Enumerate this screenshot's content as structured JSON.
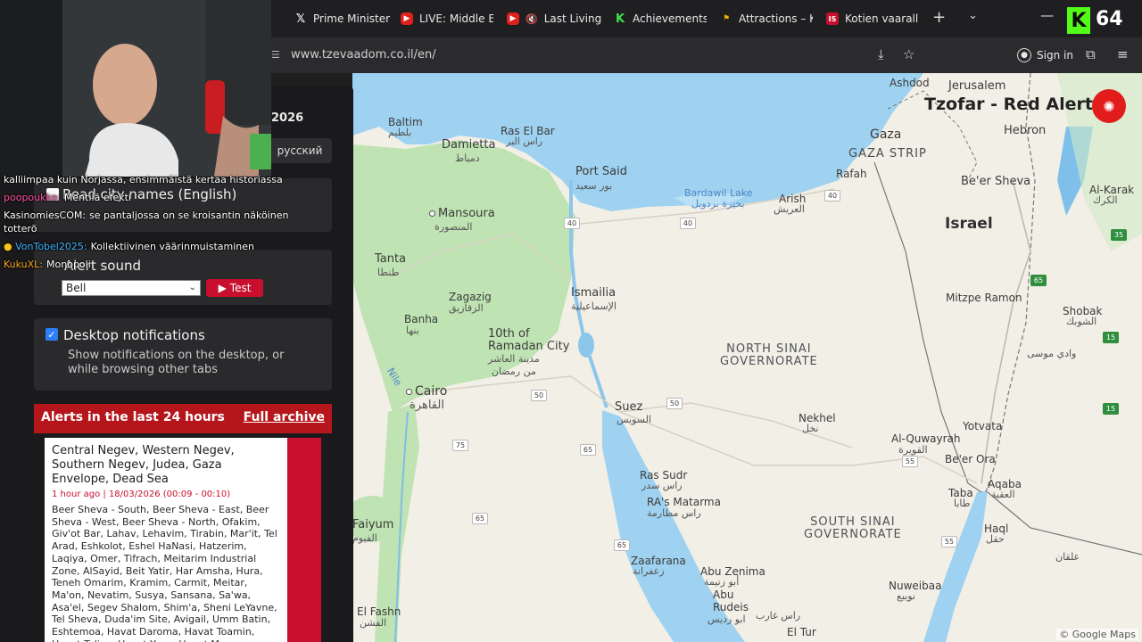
{
  "browser": {
    "tabs": [
      {
        "label": "Prime Minister",
        "favicon": "x-logo-icon"
      },
      {
        "label": "LIVE: Middle Ea",
        "favicon": "youtube-icon"
      },
      {
        "label": "Last Living",
        "favicon": "youtube-icon"
      },
      {
        "label": "Achievements -",
        "favicon": "kick-icon"
      },
      {
        "label": "Attractions – Ku",
        "favicon": "flag-icon"
      },
      {
        "label": "Kotien vaarallis",
        "favicon": "is-icon"
      }
    ],
    "url": "www.tzevaadom.co.il/en/",
    "signin_label": "Sign in",
    "viewer_count": "64",
    "kick_badge": "K"
  },
  "site": {
    "brand": "Tzofar - Red Alert",
    "year_partial": "2026",
    "language_button": "русский",
    "read_city_names": "Read city names (English)",
    "alert_sound_label": "Alert sound",
    "sound_selected": "Bell",
    "test_button": "Test",
    "desktop_notifications_title": "Desktop notifications",
    "desktop_notifications_desc": "Show notifications on the desktop, or while browsing other tabs",
    "alerts_header": "Alerts in the last 24 hours",
    "full_archive": "Full archive",
    "alert": {
      "regions": "Central Negev, Western Negev, Southern Negev, Judea, Gaza Envelope, Dead Sea",
      "time": "1 hour ago | 18/03/2026 (00:09 - 00:10)",
      "cities": "Beer Sheva - South, Beer Sheva - East, Beer Sheva - West, Beer Sheva - North, Ofakim, Giv'ot Bar, Lahav, Lehavim, Tirabin, Mar'it, Tel Arad, Eshkolot, Eshel HaNasi, Hatzerim, Laqiya, Omer, Tifrach, Meitarim Industrial Zone, AlSayid, Beit Yatir, Har Amsha, Hura, Teneh Omarim, Kramim, Carmit, Meitar, Ma'on, Nevatim, Susya, Sansana, Sa'wa, Asa'el, Segev Shalom, Shim'a, Sheni LeYavne, Tel Sheva, Duda'im Site, Avigail, Umm Batin, Eshtemoa, Havat Daroma, Havat Toamin, Havat Taliya, Havat Yoyo, Havat Mor Ve'Avraham, Havat Menachem, Havat Mikne"
    }
  },
  "chat": [
    {
      "user": "",
      "text": "kalliimpaa kuin Norjassa, ensimmäistä kertaa historiassa",
      "color": "#ffffff"
    },
    {
      "user": "poopoukko:",
      "text": "Mentilä efekti",
      "color": "#ff4fa0"
    },
    {
      "user": "KasinomiesCOM:",
      "text": "se pantaljossa on se kroisantin näköinen",
      "color": "#ffffff"
    },
    {
      "user": "",
      "text": "totterö",
      "color": "#ffffff"
    },
    {
      "user": "VonTobel2025:",
      "text": "Kollektiivinen väärinmuistaminen",
      "color": "#3fb5ff"
    },
    {
      "user": "KukuXL:",
      "text": "Monopoli",
      "color": "#f5a623"
    }
  ],
  "map": {
    "labels": {
      "baltim": "Baltim",
      "baltim_ar": "بلطيم",
      "damietta": "Damietta",
      "damietta_ar": "دمياط",
      "rasalbar": "Ras El Bar",
      "rasalbar_ar": "راس البر",
      "portsaid": "Port Said",
      "portsaid_ar": "بور سعيد",
      "bardawil": "Bardawil Lake",
      "bardawil_ar": "بحيرة بردويل",
      "arish": "Arish",
      "arish_ar": "العريش",
      "mansoura": "Mansoura",
      "mansoura_ar": "المنصورة",
      "tanta": "Tanta",
      "tanta_ar": "طنطا",
      "zagazig": "Zagazig",
      "zagazig_ar": "الزقازيق",
      "ismailia": "Ismailia",
      "ismailia_ar": "الإسماعيلية",
      "banha": "Banha",
      "banha_ar": "بنها",
      "ramadan": "10th of\nRamadan City",
      "ramadan_ar": "مدينة العاشر\nمن رمضان",
      "cairo": "Cairo",
      "cairo_ar": "القاهرة",
      "suez": "Suez",
      "suez_ar": "السويس",
      "nekhel": "Nekhel",
      "nekhel_ar": "نخل",
      "nsinai": "NORTH SINAI\nGOVERNORATE",
      "ssinai": "SOUTH SINAI\nGOVERNORATE",
      "rassudr": "Ras Sudr",
      "rassudr_ar": "راس سدر",
      "rasmatarma": "RA's Matarma",
      "rasmatarma_ar": "راس مطارمة",
      "zaafarana": "Zaafarana",
      "zaafarana_ar": "زعفرانة",
      "abuzenima": "Abu Zenima",
      "abuzenima_ar": "أبو زنيمة",
      "aburudeis": "Abu\nRudeis",
      "aburudeis_ar": "ابو رديس",
      "rasgharib": "راس غارب",
      "faiyum": "Faiyum",
      "faiyum_ar": "الفيوم",
      "elfashn": "El Fashn",
      "elfashn_ar": "الفشن",
      "nuweiba": "Nuweibaa",
      "nuweiba_ar": "نويبع",
      "eltur": "El Tur",
      "eltur_ar": "الطور",
      "taba": "Taba",
      "taba_ar": "طابا",
      "beerotvim": "Be'er Ora",
      "yotvata": "Yotvata",
      "alquwayrah": "Al-Quwayrah",
      "alquwayrah_ar": "القويرة",
      "aqaba": "Aqaba",
      "aqaba_ar": "العقبة",
      "haql": "Haql",
      "haql_ar": "حقل",
      "alqan": "علقان",
      "shobak": "Shobak",
      "shobak_ar": "الشوبك",
      "wadimusa": "وادي موسى",
      "mitzperamon": "Mitzpe Ramon",
      "israel": "Israel",
      "gaza": "Gaza",
      "gazastrip": "GAZA STRIP",
      "rafah": "Rafah",
      "beersheva": "Be'er Sheva",
      "hebron": "Hebron",
      "ashdod": "Ashdod",
      "jerusalem": "Jerusalem",
      "alkarak": "Al-Karak",
      "alkarak_ar": "الكرك",
      "nile": "Nile",
      "attribution": "© Google Maps"
    },
    "roads": [
      "40",
      "40",
      "40",
      "50",
      "50",
      "55",
      "55",
      "65",
      "65",
      "75",
      "65",
      "40",
      "15",
      "15",
      "35",
      "65"
    ]
  },
  "colors": {
    "accent_red": "#c8102e",
    "panel": "#2a2a2d",
    "sea": "#9fd2f0"
  }
}
